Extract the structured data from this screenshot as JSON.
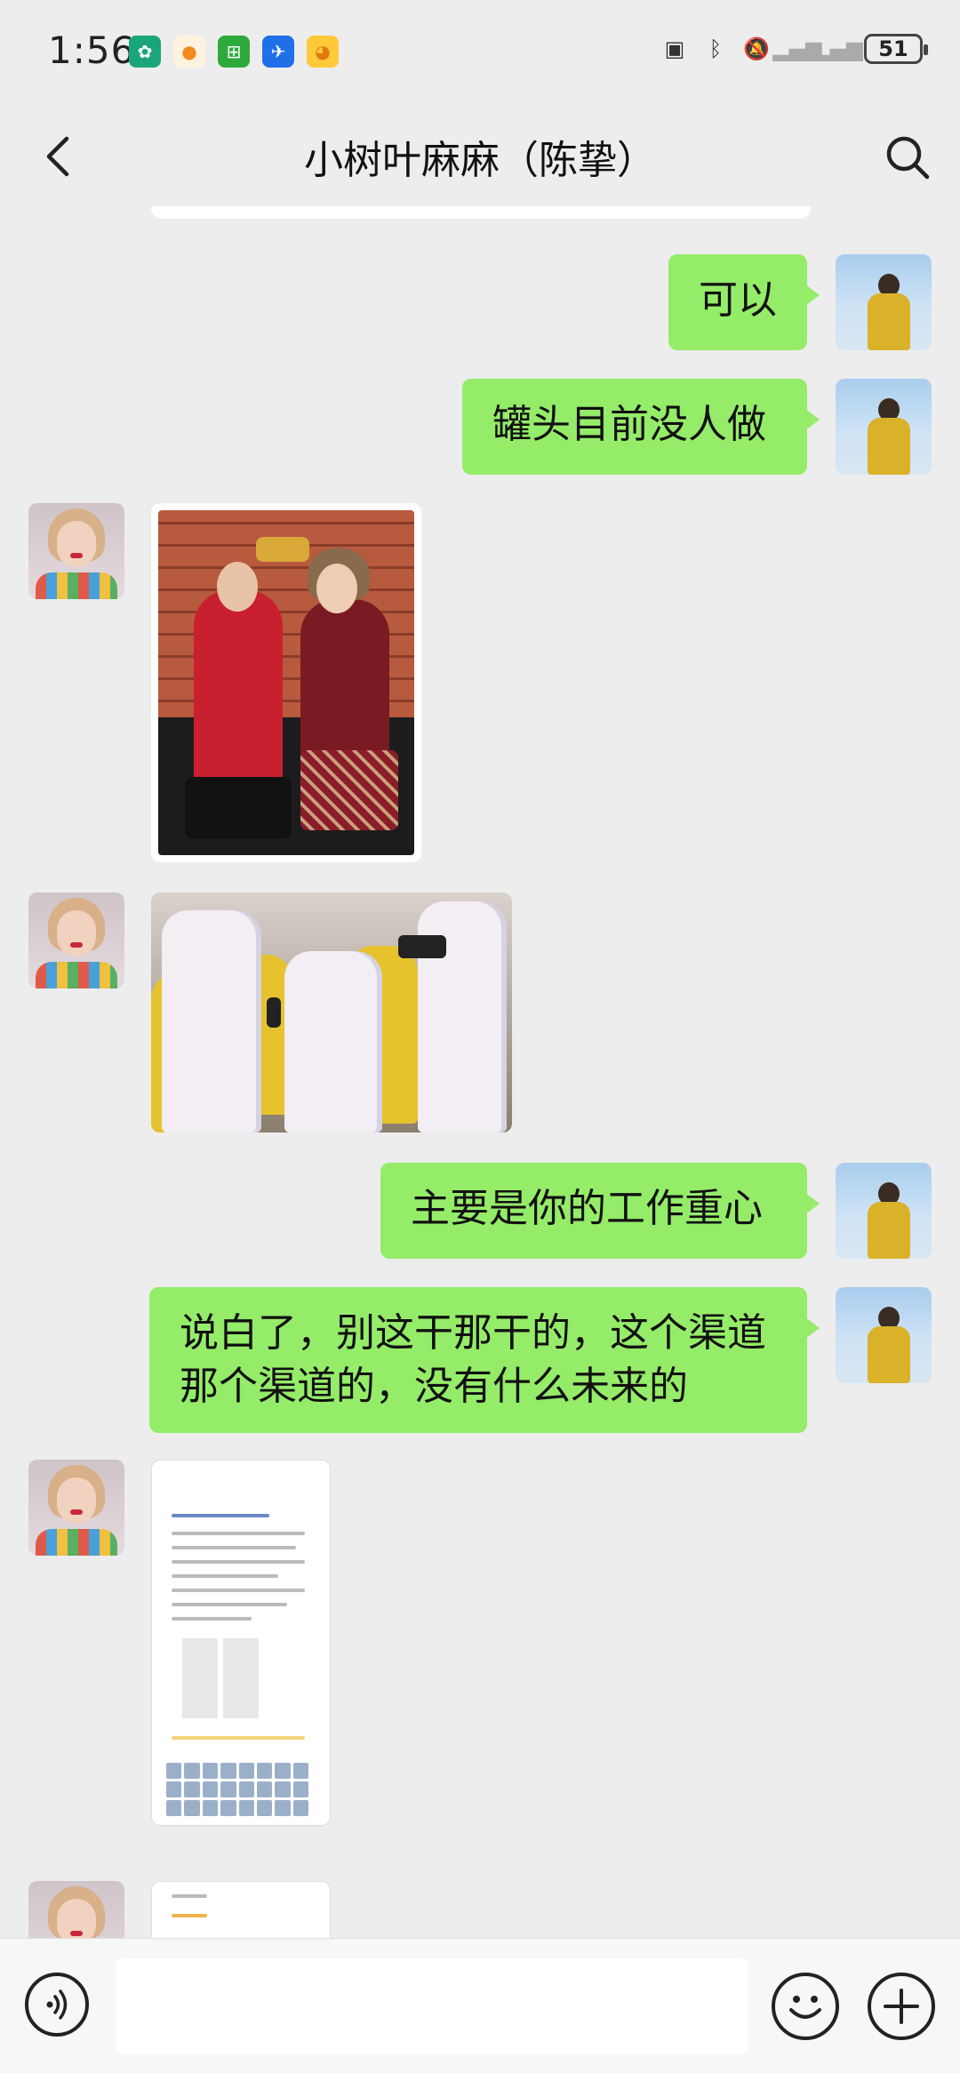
{
  "status_bar": {
    "time": "1:56",
    "battery": "51",
    "app_icons": [
      "leaf-app-icon",
      "orange-app-icon",
      "green-app-icon",
      "plane-app-icon",
      "duck-app-icon"
    ],
    "system_icons": [
      "nfc-icon",
      "bluetooth-icon",
      "mute-icon",
      "signal-1-icon",
      "signal-2-icon"
    ]
  },
  "header": {
    "title": "小树叶麻麻（陈挚）",
    "back_icon": "chevron-left-icon",
    "search_icon": "search-icon"
  },
  "messages": [
    {
      "from": "me",
      "type": "text",
      "text": "可以"
    },
    {
      "from": "me",
      "type": "text",
      "text": "罐头目前没人做"
    },
    {
      "from": "them",
      "type": "image",
      "image": "couple-photo"
    },
    {
      "from": "them",
      "type": "image",
      "image": "factory-photo"
    },
    {
      "from": "me",
      "type": "text",
      "text": "主要是你的工作重心"
    },
    {
      "from": "me",
      "type": "text",
      "text": "说白了，别这干那干的，这个渠道那个渠道的，没有什么未来的"
    },
    {
      "from": "them",
      "type": "image",
      "image": "screenshot-thumbnail"
    },
    {
      "from": "them",
      "type": "image",
      "image": "screenshot-thumbnail-2"
    }
  ],
  "input_bar": {
    "voice_icon": "voice-icon",
    "emoji_icon": "emoji-icon",
    "plus_icon": "plus-icon",
    "input_value": ""
  },
  "colors": {
    "background": "#ededed",
    "my_bubble": "#95ec69",
    "input_bar": "#f7f7f7"
  }
}
